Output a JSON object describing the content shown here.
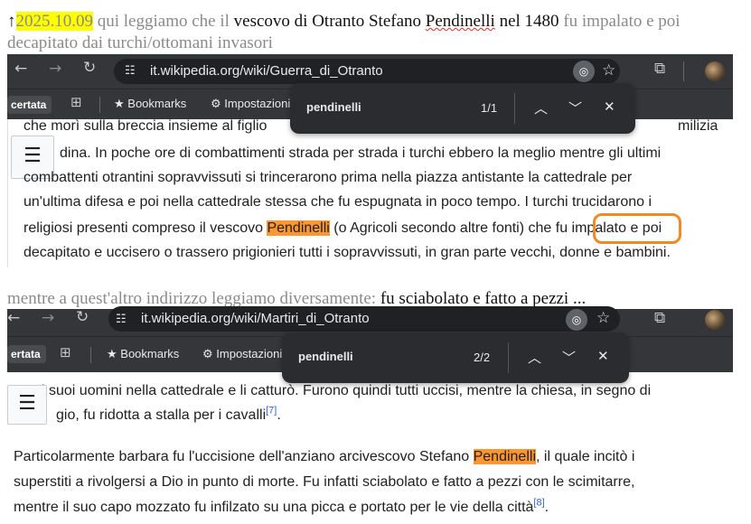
{
  "intro": {
    "arrow": "↑",
    "date": "2025.10.09",
    "part1": " qui leggiamo che il ",
    "part2": "vescovo di Otranto Stefano ",
    "name": "Pendinelli",
    "part3": " nel 1480",
    "part4": " fu impalato e poi",
    "line2": "decapitato dai turchi/ottomani invasori"
  },
  "middle": {
    "part1": "mentre a quest'altro indirizzo leggiamo diversamente: ",
    "part2": "fu sciabolato e fatto a pezzi ..."
  },
  "browser1": {
    "url": "it.wikipedia.org/wiki/Guerra_di_Otranto",
    "bookmark_first": "certata",
    "bookmarks_label": "Bookmarks",
    "settings_label": "Impostazioni",
    "find_term": "pendinelli",
    "find_count": "1/1"
  },
  "browser2": {
    "url": "it.wikipedia.org/wiki/Martiri_di_Otranto",
    "bookmark_first": "ertata",
    "bookmarks_label": "Bookmarks",
    "settings_label": "Impostazioni",
    "find_term": "pendinelli",
    "find_count": "2/2"
  },
  "wiki1": {
    "line0": "che morì sulla breccia insieme al figlio",
    "line0_right": "milizia",
    "line1": "dina. In poche ore di combattimenti strada per strada i turchi ebbero la meglio mentre gli ultimi",
    "line2": "combattenti otrantini sopravvissuti si trincerarono prima nella piazza antistante la cattedrale per",
    "line3": "un'ultima difesa e poi nella cattedrale stessa che fu espugnata in poco tempo. I turchi trucidarono i",
    "line4a": "religiosi presenti compreso il vescovo ",
    "line4_hl": "Pendinelli",
    "line4b": " (o Agricoli secondo altre fonti) che ",
    "line4_circled": "fu impalato",
    "line4c": " e poi",
    "line5": "decapitato e uccisero o trassero prigionieri tutti i sopravvissuti, in gran parte vecchi, donne e bambini."
  },
  "wiki2": {
    "line0": "i suoi uomini nella cattedrale e li catturò. Furono quindi tutti uccisi, mentre la chiesa, in segno di",
    "line1": "gio, fu ridotta a stalla per i cavalli",
    "ref1": "[7]",
    "line1_end": ".",
    "p2_line1a": "Particolarmente barbara fu l'uccisione dell'anziano arcivescovo Stefano ",
    "p2_hl": "Pendinelli",
    "p2_line1b": ", il quale incitò i",
    "p2_line2": "superstiti a rivolgersi a Dio in punto di morte. Fu infatti sciabolato e fatto a pezzi con le scimitarre,",
    "p2_line3": "mentre il suo capo mozzato fu infilzato su una picca e portato per le vie della città",
    "ref2": "[8]",
    "p2_line3_end": "."
  },
  "icons": {
    "back": "back-arrow-icon",
    "forward": "forward-arrow-icon",
    "reload": "reload-icon",
    "tune": "site-settings-icon",
    "lens": "google-lens-icon",
    "star": "star-icon",
    "extensions": "extensions-icon",
    "menu": "menu-icon",
    "apps": "apps-grid-icon",
    "gear": "gear-icon",
    "up": "chevron-up-icon",
    "down": "chevron-down-icon",
    "close": "close-icon",
    "toc": "list-icon"
  },
  "colors": {
    "chrome": "#35363a",
    "find_highlight": "#ff9632",
    "circle": "#f08a24",
    "date_highlight": "#ffff00"
  }
}
